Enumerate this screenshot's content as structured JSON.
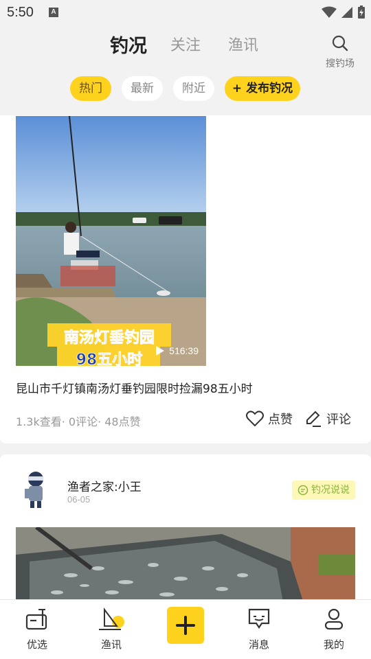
{
  "status_bar": {
    "time": "5:50",
    "a_label": "A"
  },
  "header": {
    "tabs": [
      {
        "label": "钓况",
        "active": true
      },
      {
        "label": "关注",
        "active": false
      },
      {
        "label": "渔讯",
        "active": false
      }
    ],
    "search_label": "搜钓场",
    "chips": [
      {
        "label": "热门",
        "active": true
      },
      {
        "label": "最新",
        "active": false
      },
      {
        "label": "附近",
        "active": false
      }
    ],
    "publish_label": "+ 发布钓况"
  },
  "post1": {
    "video_overlay_line1": "南汤灯垂钓园",
    "video_overlay_line2": "98五小时",
    "duration": "516:39",
    "title": "昆山市千灯镇南汤灯垂钓园限时捡漏98五小时",
    "stats": "1.3k查看· 0评论· 48点赞",
    "like_label": "点赞",
    "comment_label": "评论"
  },
  "post2": {
    "author": "渔者之家:小王",
    "date": "06-05",
    "tag": "钓况说说"
  },
  "bottom_nav": {
    "items": [
      {
        "label": "优选"
      },
      {
        "label": "渔讯"
      },
      {
        "label": "消息"
      },
      {
        "label": "我的"
      }
    ]
  },
  "colors": {
    "accent": "#ffd21e",
    "tag_bg": "#fdf7b8",
    "tag_text": "#8ab33a"
  }
}
